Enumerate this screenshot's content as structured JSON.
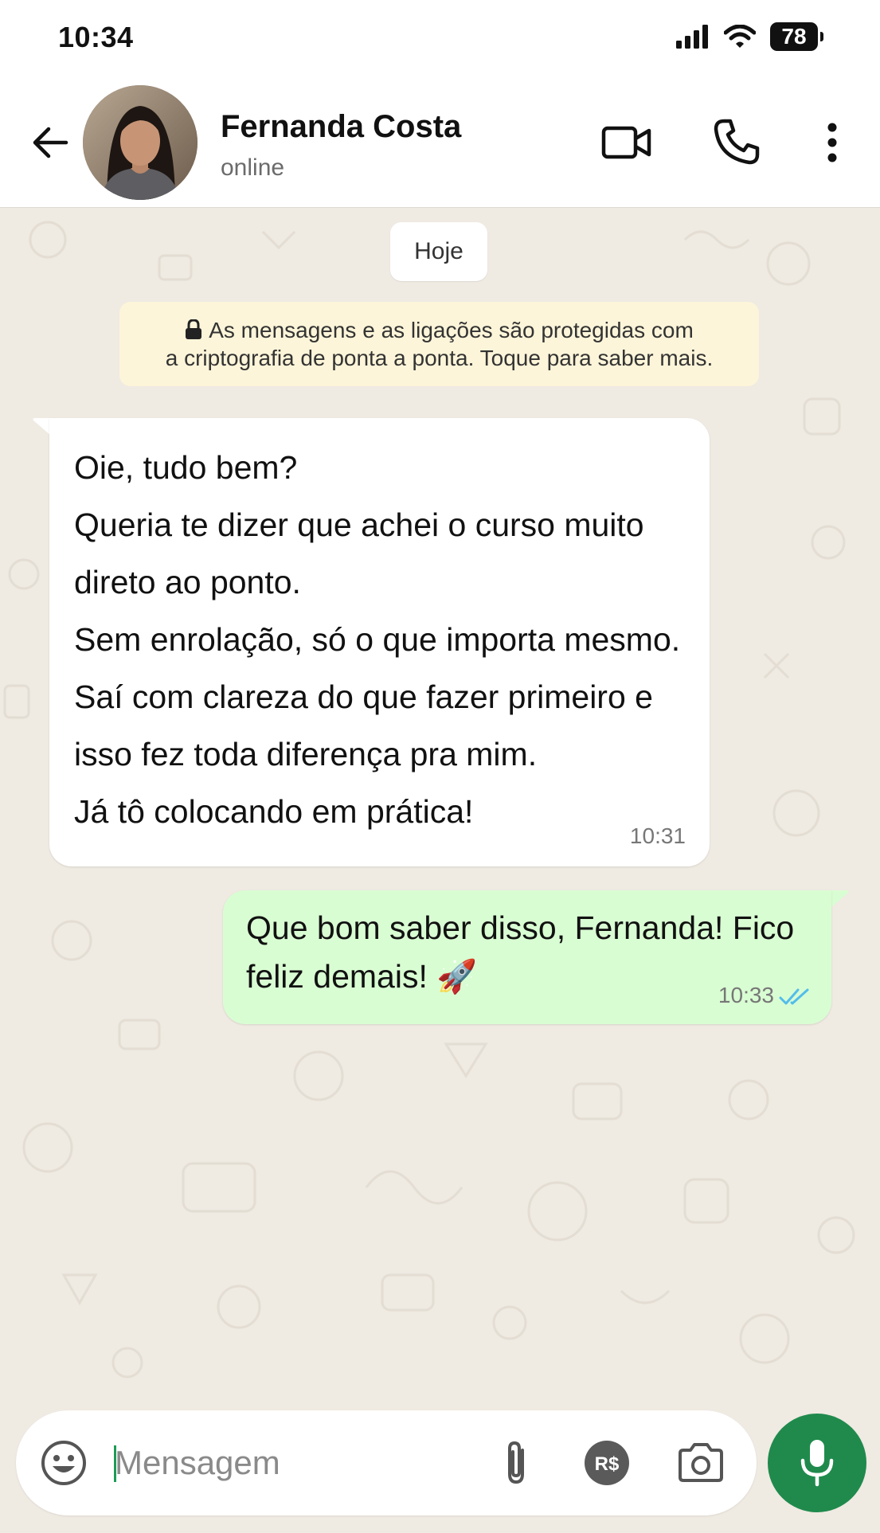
{
  "status_bar": {
    "time": "10:34",
    "battery": "78"
  },
  "header": {
    "contact_name": "Fernanda Costa",
    "contact_status": "online"
  },
  "chat": {
    "date_chip": "Hoje",
    "encryption_notice": {
      "line1": "As mensagens e as ligações são protegidas com",
      "line2": "a criptografia de ponta a ponta. Toque para saber mais."
    },
    "messages": [
      {
        "direction": "incoming",
        "lines": [
          "Oie, tudo bem?",
          "Queria te dizer que achei o curso muito",
          "direto ao ponto.",
          "Sem enrolação, só o que importa mesmo.",
          "Saí com clareza do que fazer primeiro e",
          "isso fez toda diferença pra mim.",
          "Já tô colocando em prática!"
        ],
        "time": "10:31"
      },
      {
        "direction": "outgoing",
        "lines": [
          "Que bom saber disso, Fernanda! Fico",
          "feliz demais! 🚀"
        ],
        "time": "10:33",
        "status": "read"
      }
    ]
  },
  "composer": {
    "placeholder": "Mensagem"
  },
  "colors": {
    "outgoing_bubble": "#d9fdd3",
    "incoming_bubble": "#ffffff",
    "chat_background": "#efeae2",
    "encryption_notice_bg": "#fdf5d9",
    "accent_green": "#1f8a4c",
    "read_ticks": "#53bdeb"
  },
  "icons": {
    "back": "arrow-left-icon",
    "video_call": "video-camera-icon",
    "voice_call": "phone-icon",
    "more": "more-vertical-icon",
    "lock": "lock-icon",
    "emoji": "emoji-icon",
    "attach": "paperclip-icon",
    "payment": "payment-icon",
    "camera": "camera-icon",
    "mic": "microphone-icon",
    "read_ticks": "double-check-icon"
  }
}
